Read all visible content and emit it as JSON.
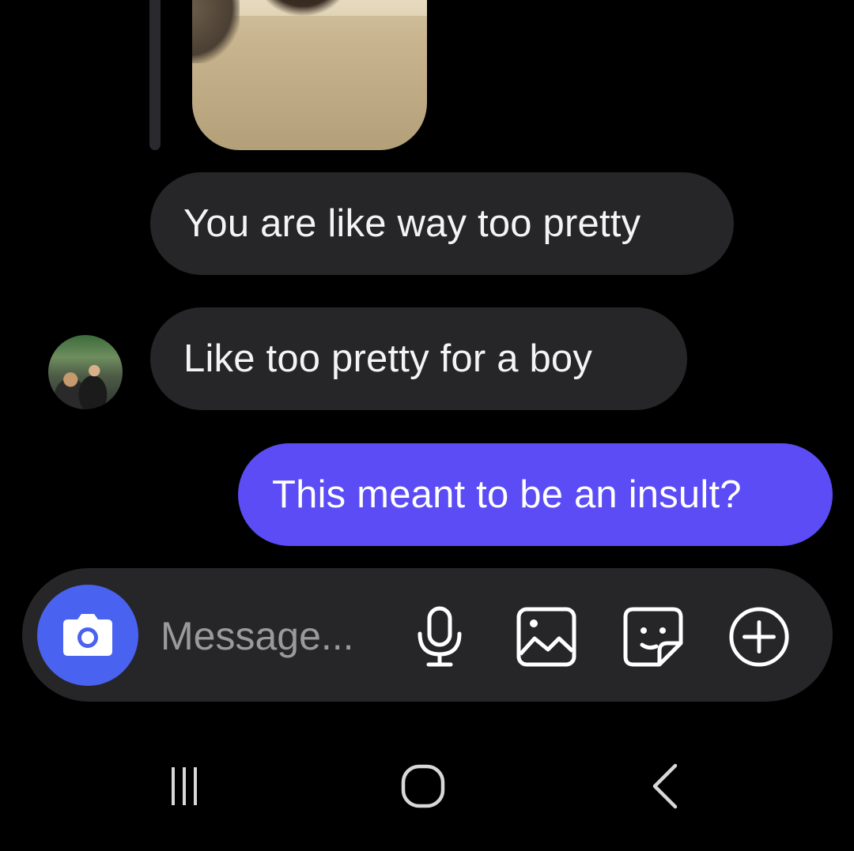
{
  "messages": [
    {
      "text": "You are like way too pretty",
      "direction": "incoming"
    },
    {
      "text": "Like too pretty for a boy",
      "direction": "incoming"
    },
    {
      "text": "This meant to be an insult?",
      "direction": "outgoing"
    }
  ],
  "composer": {
    "placeholder": "Message...",
    "icons": [
      "camera-icon",
      "microphone-icon",
      "gallery-icon",
      "sticker-icon",
      "plus-circle-icon"
    ]
  },
  "navbar": {
    "icons": [
      "recent-apps-icon",
      "home-icon",
      "back-icon"
    ]
  },
  "colors": {
    "background": "#000000",
    "incoming_bubble": "#262628",
    "outgoing_bubble": "#5b4cf5",
    "camera_button": "#4a62f0",
    "composer": "#262628"
  }
}
